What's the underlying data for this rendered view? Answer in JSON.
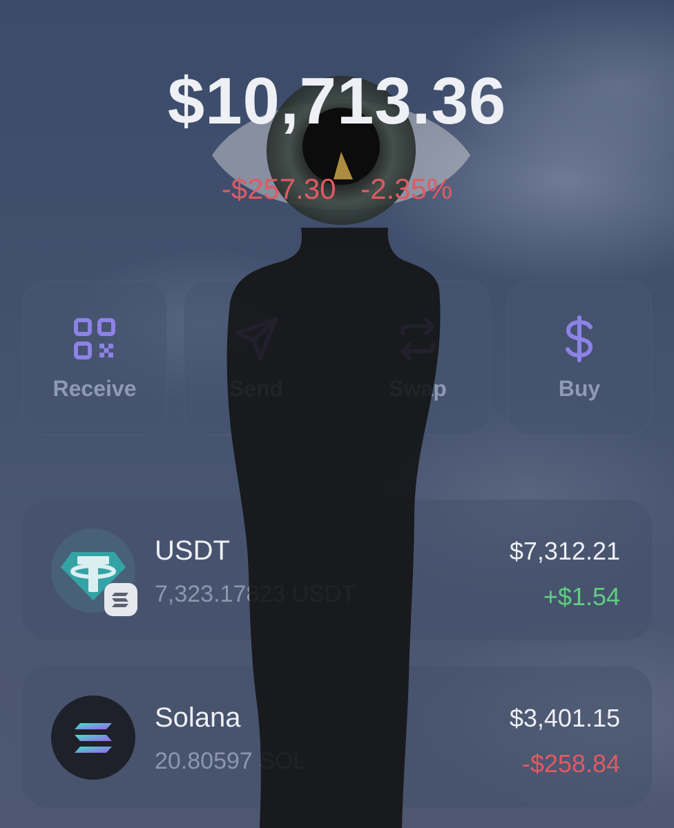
{
  "header": {
    "balance": "$10,713.36",
    "change_amount": "-$257.30",
    "change_percent": "-2.35%"
  },
  "actions": [
    {
      "label": "Receive",
      "icon": "qr-code-icon"
    },
    {
      "label": "Send",
      "icon": "send-arrow-icon"
    },
    {
      "label": "Swap",
      "icon": "swap-arrows-icon"
    },
    {
      "label": "Buy",
      "icon": "dollar-icon"
    }
  ],
  "tokens": [
    {
      "name": "USDT",
      "amount": "7,323.17823 USDT",
      "value": "$7,312.21",
      "pnl": "+$1.54",
      "pnl_direction": "up",
      "icon": "tether-logo-icon",
      "badge_icon": "solana-chain-badge-icon"
    },
    {
      "name": "Solana",
      "amount": "20.80597 SOL",
      "value": "$3,401.15",
      "pnl": "-$258.84",
      "pnl_direction": "down",
      "icon": "solana-logo-icon"
    }
  ],
  "colors": {
    "accent": "#8d82e6",
    "positive": "#5fcf80",
    "negative": "#e05a63",
    "card_bg": "#44506a"
  }
}
